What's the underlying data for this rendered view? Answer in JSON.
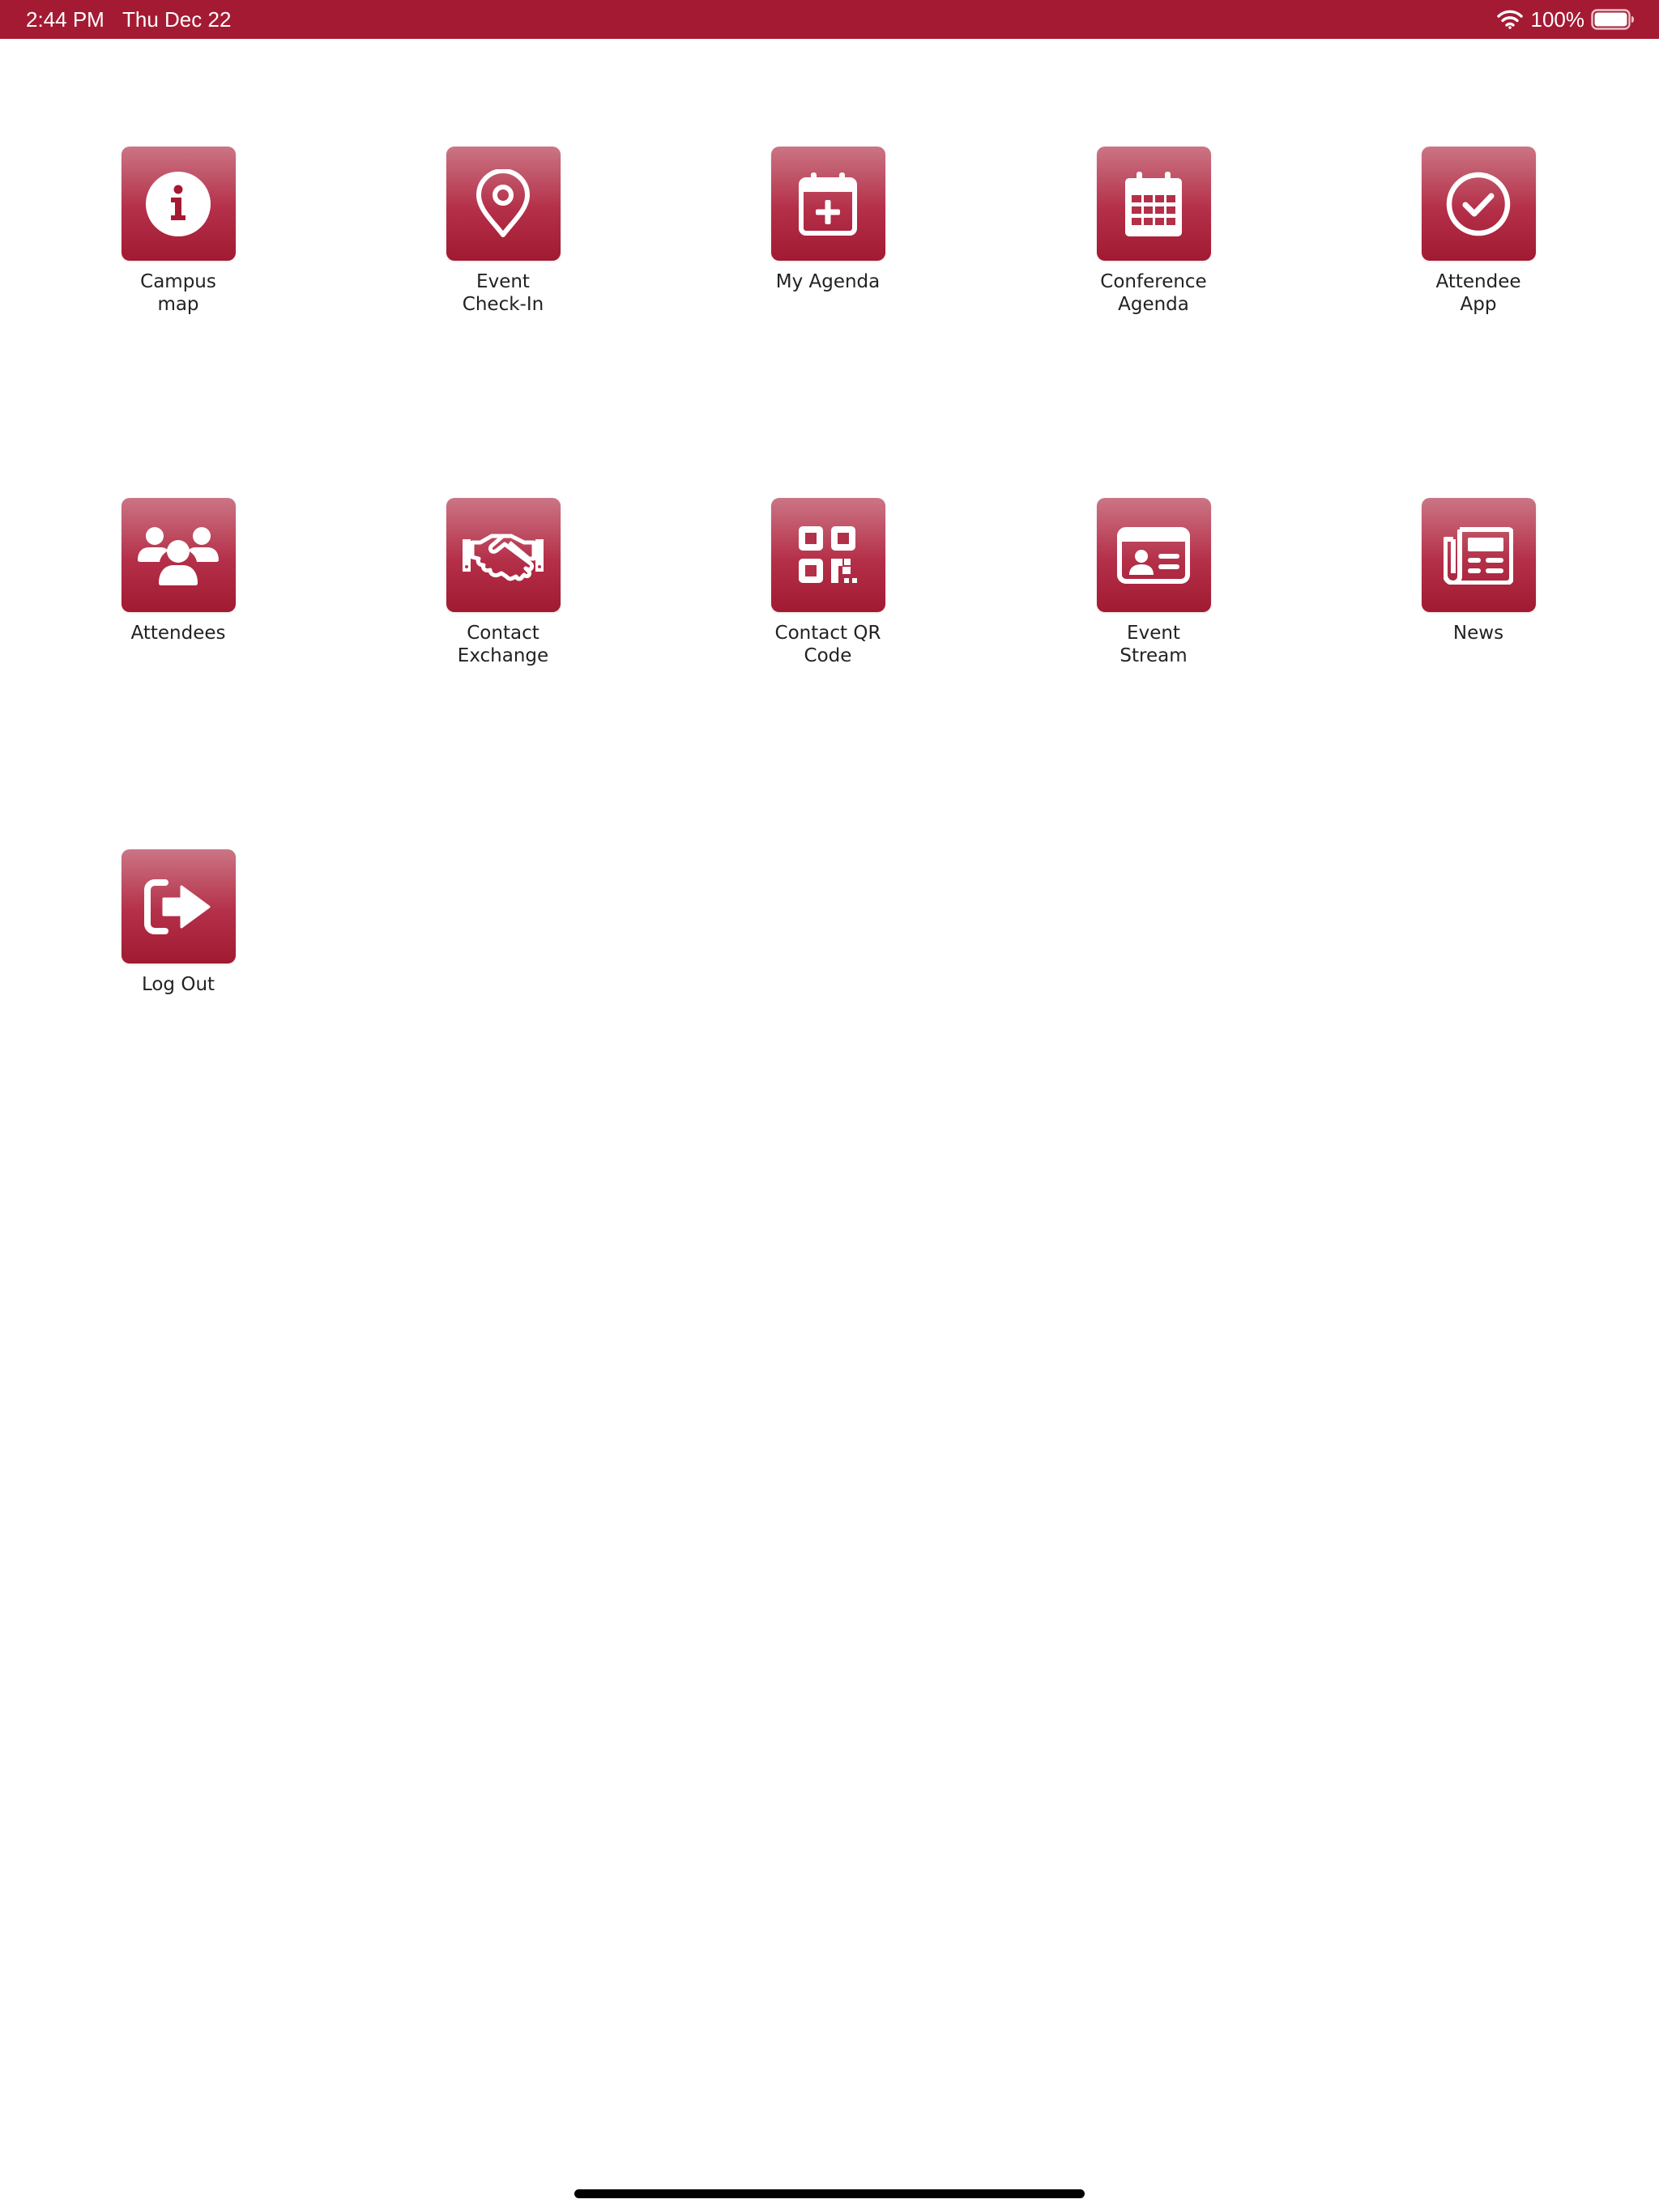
{
  "status_bar": {
    "time": "2:44 PM",
    "date": "Thu Dec 22",
    "battery": "100%",
    "color": "#a51a33"
  },
  "tiles": [
    {
      "label": "Campus\nmap",
      "icon": "info-icon"
    },
    {
      "label": "Event\nCheck-In",
      "icon": "map-pin-icon"
    },
    {
      "label": "My Agenda",
      "icon": "calendar-plus-icon"
    },
    {
      "label": "Conference\nAgenda",
      "icon": "calendar-grid-icon"
    },
    {
      "label": "Attendee\nApp",
      "icon": "check-circle-icon"
    },
    {
      "label": "Attendees",
      "icon": "users-icon"
    },
    {
      "label": "Contact\nExchange",
      "icon": "handshake-icon"
    },
    {
      "label": "Contact QR\nCode",
      "icon": "qr-code-icon"
    },
    {
      "label": "Event\nStream",
      "icon": "id-card-icon"
    },
    {
      "label": "News",
      "icon": "newspaper-icon"
    },
    {
      "label": "Log Out",
      "icon": "sign-out-icon"
    }
  ]
}
